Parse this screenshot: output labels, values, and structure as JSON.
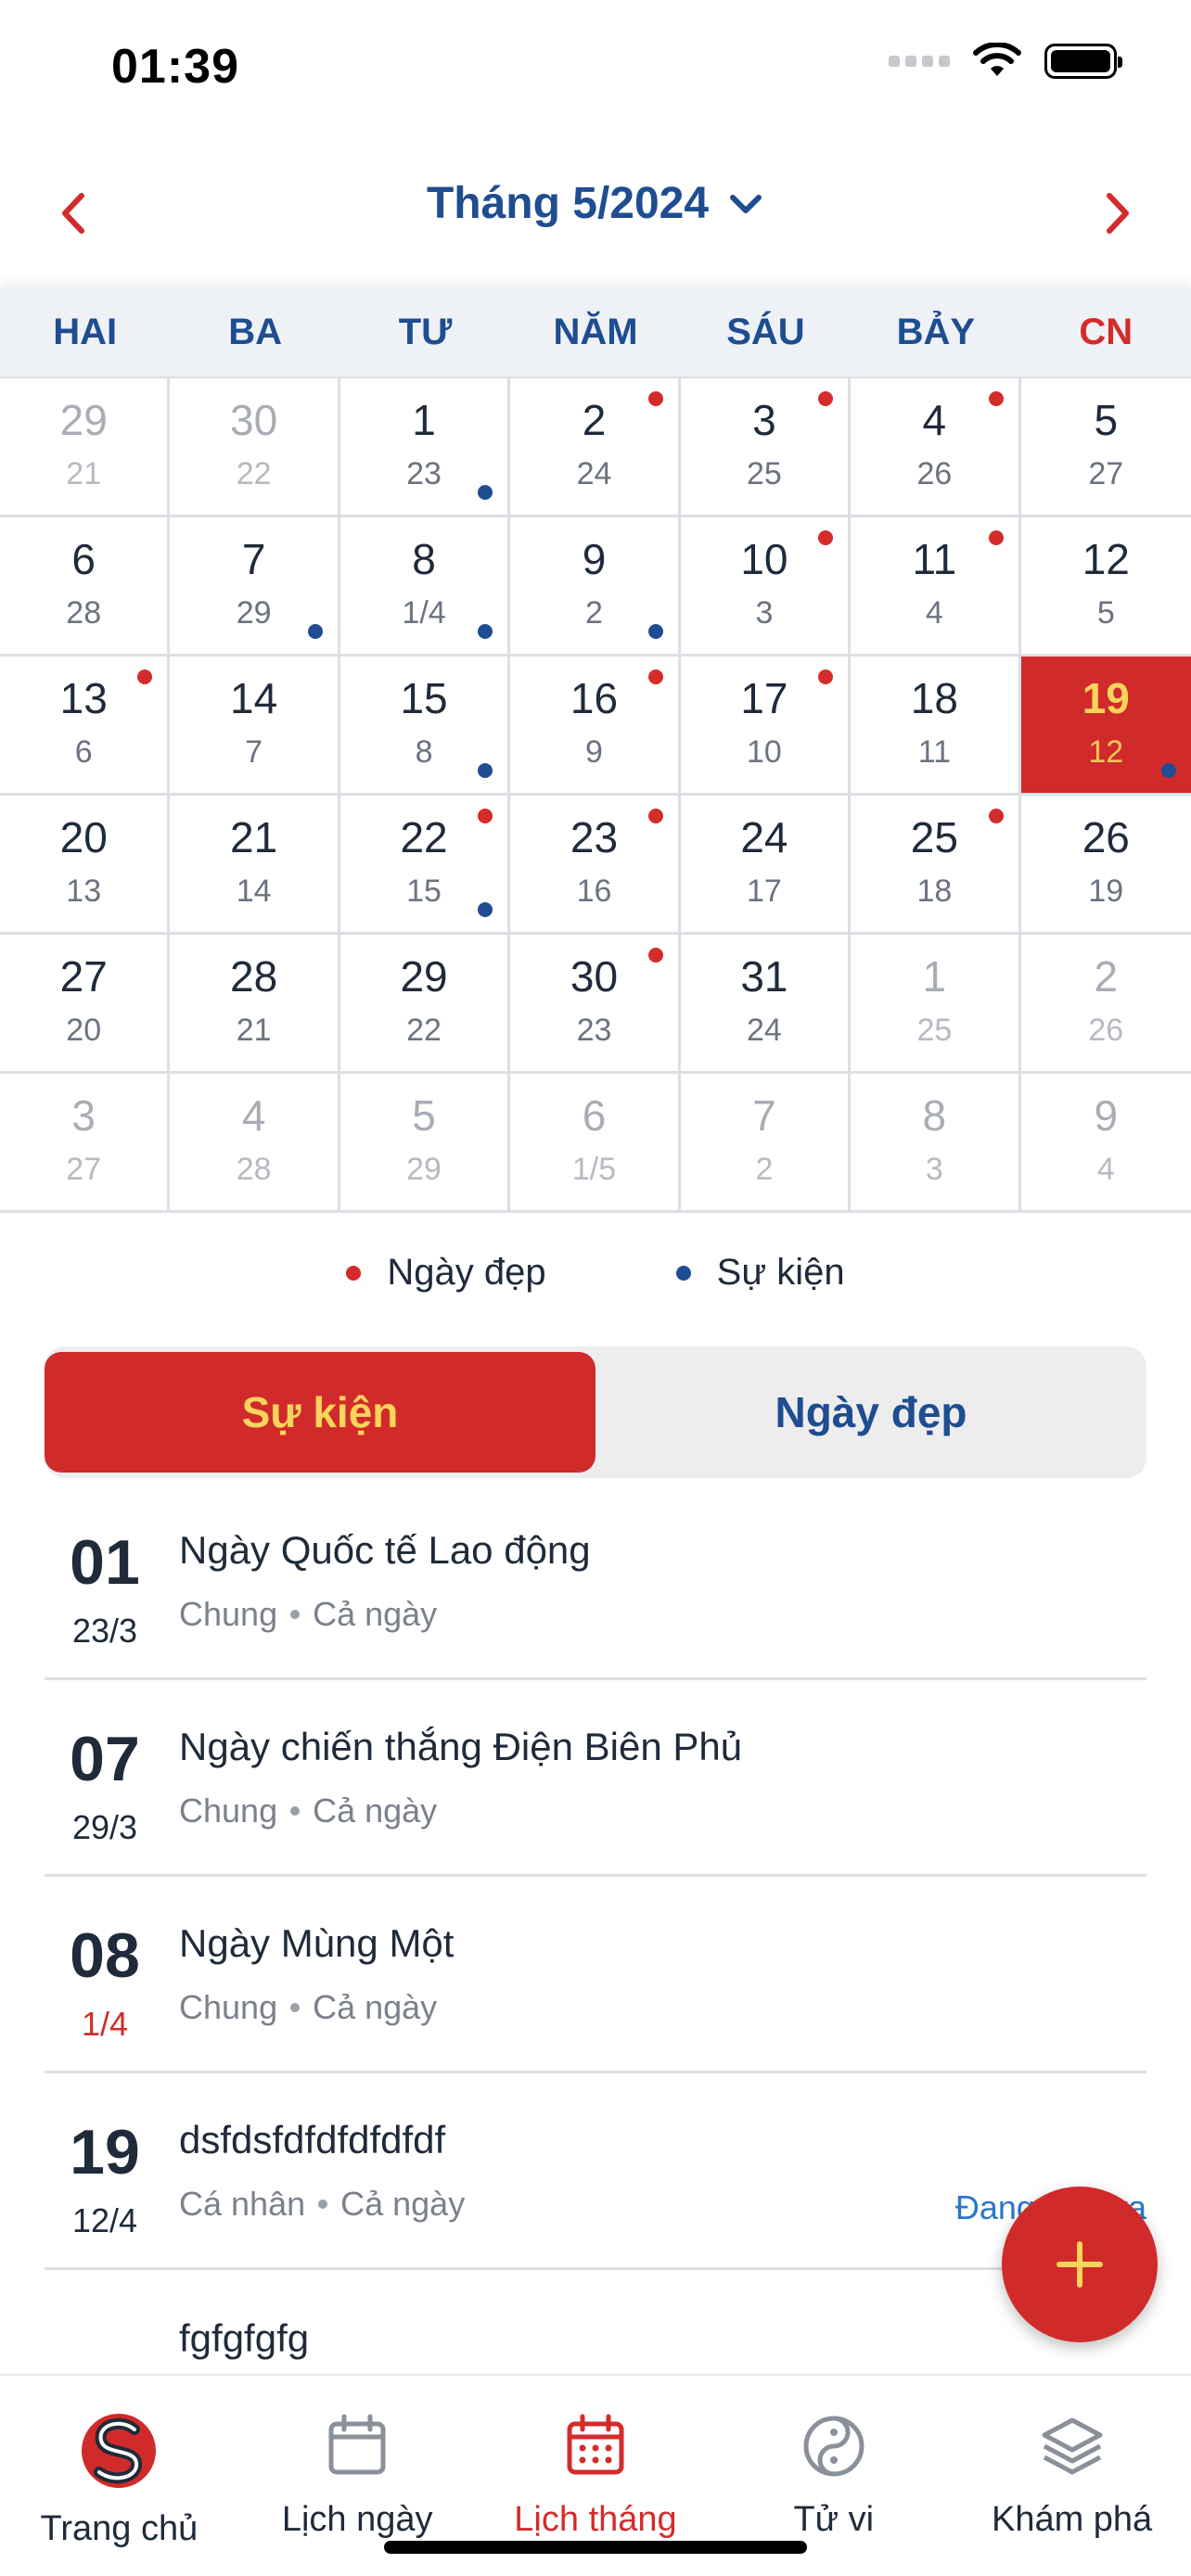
{
  "status_bar": {
    "time": "01:39"
  },
  "header": {
    "prev_icon": "chevron-left-icon",
    "title": "Tháng 5/2024",
    "dropdown_icon": "chevron-down-icon",
    "next_icon": "chevron-right-icon"
  },
  "weekdays": [
    "HAI",
    "BA",
    "TƯ",
    "NĂM",
    "SÁU",
    "BẢY",
    "CN"
  ],
  "days": [
    {
      "solar": "29",
      "lunar": "21",
      "other": true
    },
    {
      "solar": "30",
      "lunar": "22",
      "other": true
    },
    {
      "solar": "1",
      "lunar": "23",
      "event": true
    },
    {
      "solar": "2",
      "lunar": "24",
      "good": true
    },
    {
      "solar": "3",
      "lunar": "25",
      "good": true
    },
    {
      "solar": "4",
      "lunar": "26",
      "good": true
    },
    {
      "solar": "5",
      "lunar": "27"
    },
    {
      "solar": "6",
      "lunar": "28"
    },
    {
      "solar": "7",
      "lunar": "29",
      "event": true
    },
    {
      "solar": "8",
      "lunar": "1/4",
      "event": true
    },
    {
      "solar": "9",
      "lunar": "2",
      "event": true
    },
    {
      "solar": "10",
      "lunar": "3",
      "good": true
    },
    {
      "solar": "11",
      "lunar": "4",
      "good": true
    },
    {
      "solar": "12",
      "lunar": "5"
    },
    {
      "solar": "13",
      "lunar": "6",
      "good": true
    },
    {
      "solar": "14",
      "lunar": "7"
    },
    {
      "solar": "15",
      "lunar": "8",
      "event": true
    },
    {
      "solar": "16",
      "lunar": "9",
      "good": true
    },
    {
      "solar": "17",
      "lunar": "10",
      "good": true
    },
    {
      "solar": "18",
      "lunar": "11"
    },
    {
      "solar": "19",
      "lunar": "12",
      "today": true,
      "event": true
    },
    {
      "solar": "20",
      "lunar": "13"
    },
    {
      "solar": "21",
      "lunar": "14"
    },
    {
      "solar": "22",
      "lunar": "15",
      "good": true,
      "event": true
    },
    {
      "solar": "23",
      "lunar": "16",
      "good": true
    },
    {
      "solar": "24",
      "lunar": "17"
    },
    {
      "solar": "25",
      "lunar": "18",
      "good": true
    },
    {
      "solar": "26",
      "lunar": "19"
    },
    {
      "solar": "27",
      "lunar": "20"
    },
    {
      "solar": "28",
      "lunar": "21"
    },
    {
      "solar": "29",
      "lunar": "22"
    },
    {
      "solar": "30",
      "lunar": "23",
      "good": true
    },
    {
      "solar": "31",
      "lunar": "24"
    },
    {
      "solar": "1",
      "lunar": "25",
      "other": true
    },
    {
      "solar": "2",
      "lunar": "26",
      "other": true
    },
    {
      "solar": "3",
      "lunar": "27",
      "other": true
    },
    {
      "solar": "4",
      "lunar": "28",
      "other": true
    },
    {
      "solar": "5",
      "lunar": "29",
      "other": true
    },
    {
      "solar": "6",
      "lunar": "1/5",
      "other": true
    },
    {
      "solar": "7",
      "lunar": "2",
      "other": true
    },
    {
      "solar": "8",
      "lunar": "3",
      "other": true
    },
    {
      "solar": "9",
      "lunar": "4",
      "other": true
    }
  ],
  "legend": {
    "good_day": "Ngày đẹp",
    "event": "Sự kiện"
  },
  "colors": {
    "red": "#d12a2a",
    "blue": "#1e4d91",
    "yellow": "#f7d55a",
    "link": "#2a77c9"
  },
  "tabs": {
    "events": "Sự kiện",
    "good_days": "Ngày đẹp"
  },
  "events": [
    {
      "day": "01",
      "lunar": "23/3",
      "title": "Ngày Quốc tế Lao động",
      "category": "Chung",
      "duration": "Cả ngày",
      "status": ""
    },
    {
      "day": "07",
      "lunar": "29/3",
      "title": "Ngày chiến thắng Điện Biên Phủ",
      "category": "Chung",
      "duration": "Cả ngày",
      "status": ""
    },
    {
      "day": "08",
      "lunar": "1/4",
      "lunar_red": true,
      "title": "Ngày Mùng Một",
      "category": "Chung",
      "duration": "Cả ngày",
      "status": ""
    },
    {
      "day": "19",
      "lunar": "12/4",
      "title": "dsfdsfdfdfdfdfdf",
      "category": "Cá nhân",
      "duration": "Cả ngày",
      "status": "Đang diễn ra"
    },
    {
      "day": "",
      "lunar": "",
      "title": "fgfgfgfg",
      "category": "",
      "duration": "",
      "status": ""
    }
  ],
  "fab": {
    "icon": "plus-icon"
  },
  "bottom_nav": [
    {
      "label": "Trang chủ",
      "icon": "home-logo-icon"
    },
    {
      "label": "Lịch ngày",
      "icon": "calendar-day-icon"
    },
    {
      "label": "Lịch tháng",
      "icon": "calendar-month-icon",
      "active": true
    },
    {
      "label": "Tử vi",
      "icon": "yin-yang-icon"
    },
    {
      "label": "Khám phá",
      "icon": "layers-icon"
    }
  ]
}
